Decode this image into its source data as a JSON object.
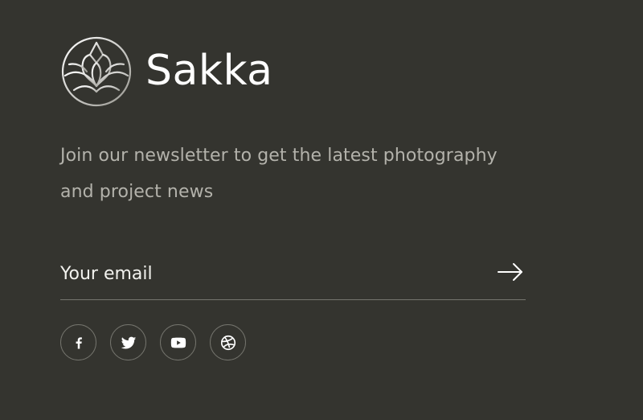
{
  "brand": {
    "name": "Sakka",
    "logo_icon": "lotus-circle-icon"
  },
  "newsletter": {
    "description": "Join our newsletter to get the latest photography and project news",
    "email_placeholder": "Your email",
    "submit_icon": "arrow-right-icon"
  },
  "social": [
    {
      "name": "Facebook",
      "icon": "facebook-icon"
    },
    {
      "name": "Twitter",
      "icon": "twitter-icon"
    },
    {
      "name": "YouTube",
      "icon": "youtube-icon"
    },
    {
      "name": "Dribbble",
      "icon": "dribbble-icon"
    }
  ],
  "colors": {
    "background": "#34342f",
    "text": "#ffffff",
    "muted_text": "#b3b2ab",
    "line": "#75756f"
  }
}
